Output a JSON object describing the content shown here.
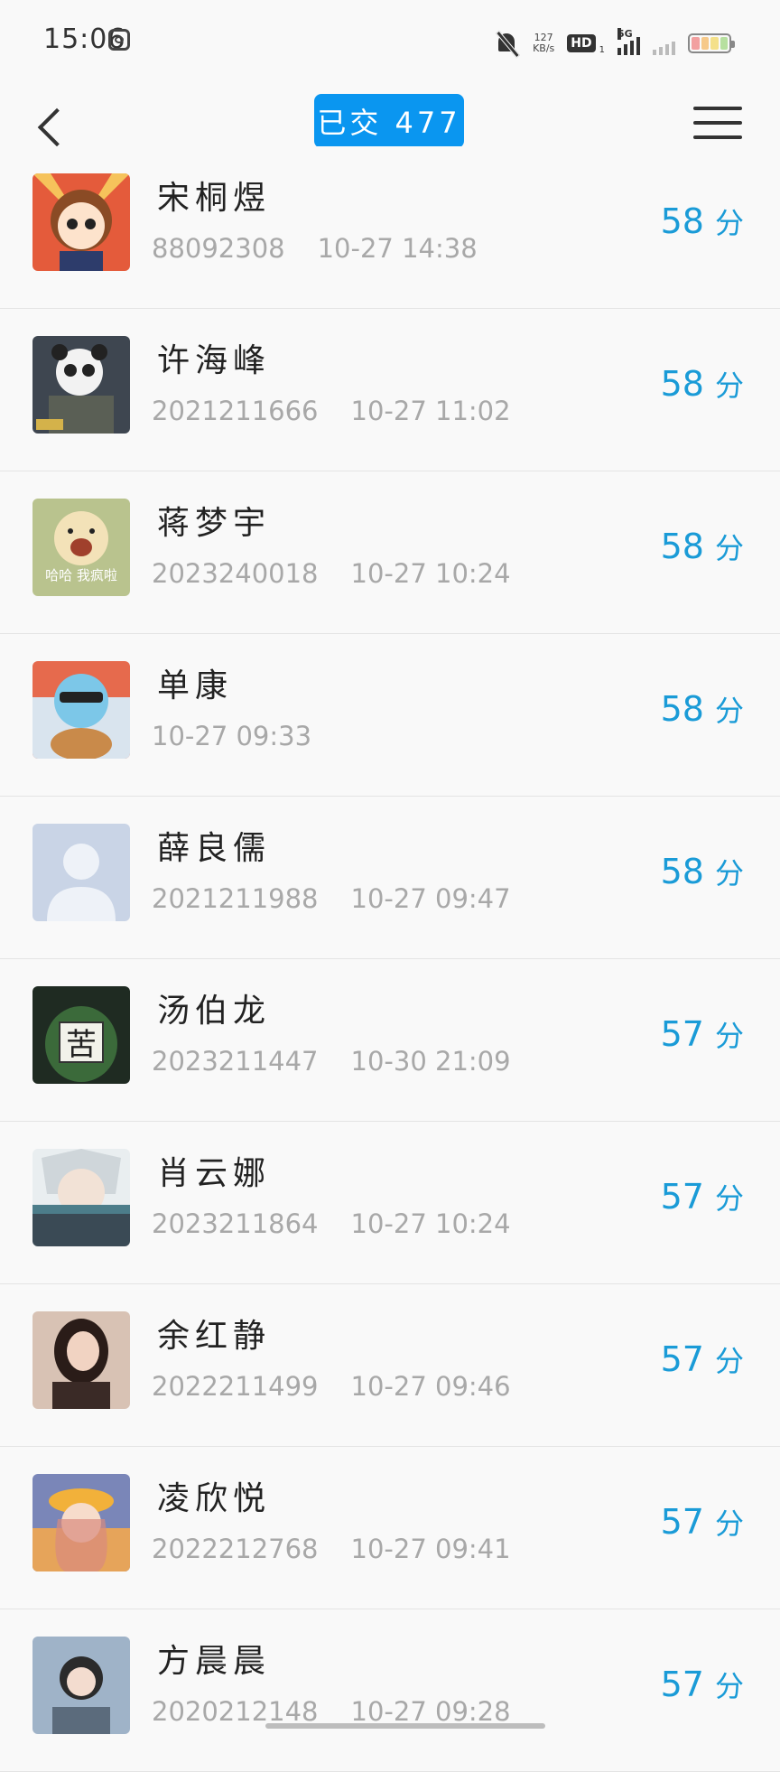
{
  "status_bar": {
    "time": "15:06",
    "net_speed_value": "127",
    "net_speed_unit": "KB/s",
    "hd_label": "HD",
    "hd_sub": "1",
    "network": "5G",
    "battery_colors": [
      "#f2a0a0",
      "#f6c98a",
      "#f4e08a",
      "#b7e0a0"
    ]
  },
  "header": {
    "title": "已交 477",
    "accent_color": "#0a96f0"
  },
  "list": {
    "items": [
      {
        "name": "宋桐煜",
        "id": "88092308",
        "time": "10-27 14:38",
        "score": "58",
        "unit": "分",
        "avatar": "anime-girl-avatar",
        "avatar_color": "#e8c98c"
      },
      {
        "name": "许海峰",
        "id": "2021211666",
        "time": "10-27 11:02",
        "score": "58",
        "unit": "分",
        "avatar": "panda-soldier-avatar",
        "avatar_color": "#3e4650"
      },
      {
        "name": "蒋梦宇",
        "id": "2023240018",
        "time": "10-27 10:24",
        "score": "58",
        "unit": "分",
        "avatar": "laughing-bear-avatar",
        "avatar_color": "#b9c38e",
        "avatar_caption": "哈哈 我疯啦"
      },
      {
        "name": "单康",
        "id": "",
        "time": "10-27 09:33",
        "score": "58",
        "unit": "分",
        "avatar": "squirtle-avatar",
        "avatar_color": "#d9e4ee"
      },
      {
        "name": "薛良儒",
        "id": "2021211988",
        "time": "10-27 09:47",
        "score": "58",
        "unit": "分",
        "avatar": "default-person-avatar",
        "avatar_color": "#c9d4e6"
      },
      {
        "name": "汤伯龙",
        "id": "2023211447",
        "time": "10-30 21:09",
        "score": "57",
        "unit": "分",
        "avatar": "melon-head-avatar",
        "avatar_color": "#3b6a3a",
        "avatar_caption": "苦"
      },
      {
        "name": "肖云娜",
        "id": "2023211864",
        "time": "10-27 10:24",
        "score": "57",
        "unit": "分",
        "avatar": "kakashi-avatar",
        "avatar_color": "#3a4a55"
      },
      {
        "name": "余红静",
        "id": "2022211499",
        "time": "10-27 09:46",
        "score": "57",
        "unit": "分",
        "avatar": "girl-photo-avatar",
        "avatar_color": "#d8c2b4"
      },
      {
        "name": "凌欣悦",
        "id": "2022212768",
        "time": "10-27 09:41",
        "score": "57",
        "unit": "分",
        "avatar": "anime-hat-girl-avatar",
        "avatar_color": "#e6a45a"
      },
      {
        "name": "方晨晨",
        "id": "2020212148",
        "time": "10-27 09:28",
        "score": "57",
        "unit": "分",
        "avatar": "girl-photo-avatar-2",
        "avatar_color": "#9fb3c8"
      }
    ]
  },
  "score_color": "#1a9bd7"
}
